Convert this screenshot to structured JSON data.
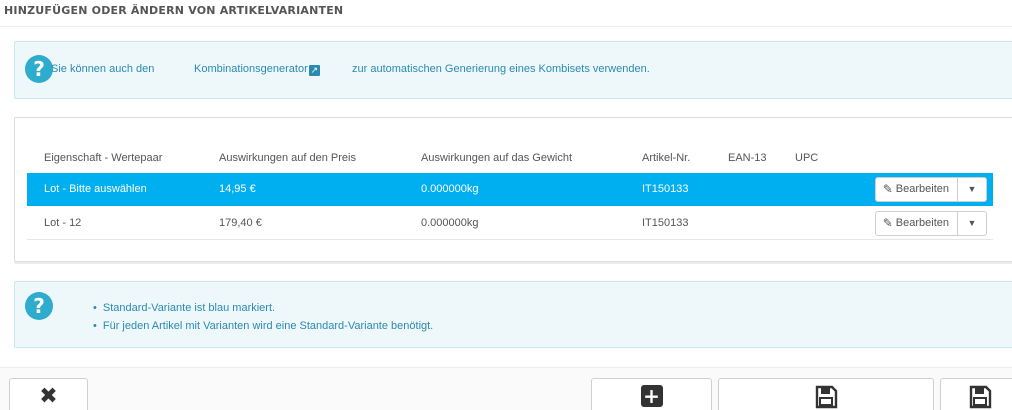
{
  "section": {
    "title": "HINZUFÜGEN ODER ÄNDERN VON ARTIKELVARIANTEN"
  },
  "info_top": {
    "text_before": "Sie können auch den",
    "link_label": "Kombinationsgenerator",
    "text_after": "zur automatischen Generierung eines Kombisets verwenden."
  },
  "table": {
    "headers": [
      "Eigenschaft - Wertepaar",
      "Auswirkungen auf den Preis",
      "Auswirkungen auf das Gewicht",
      "Artikel-Nr.",
      "EAN-13",
      "UPC"
    ],
    "rows": [
      {
        "attribute": "Lot - Bitte auswählen",
        "price": "14,95 €",
        "weight": "0.000000kg",
        "reference": "IT150133",
        "ean13": "",
        "upc": "",
        "is_default": true
      },
      {
        "attribute": "Lot - 12",
        "price": "179,40 €",
        "weight": "0.000000kg",
        "reference": "IT150133",
        "ean13": "",
        "upc": "",
        "is_default": false
      }
    ],
    "edit_label": "Bearbeiten"
  },
  "info_bottom": {
    "bullets": [
      "Standard-Variante ist blau markiert.",
      "Für jeden Artikel mit Varianten wird eine Standard-Variante benötigt."
    ]
  },
  "icons": {
    "help": "question-circle-icon",
    "external_link": "external-link-icon",
    "edit": "pencil-icon",
    "dropdown": "caret-down-icon",
    "cancel": "close-icon",
    "add": "plus-square-icon",
    "save": "floppy-disk-icon"
  },
  "colors": {
    "highlight_row": "#00aff0",
    "info_background": "#eef8fb",
    "info_text": "#2a8ab0"
  }
}
